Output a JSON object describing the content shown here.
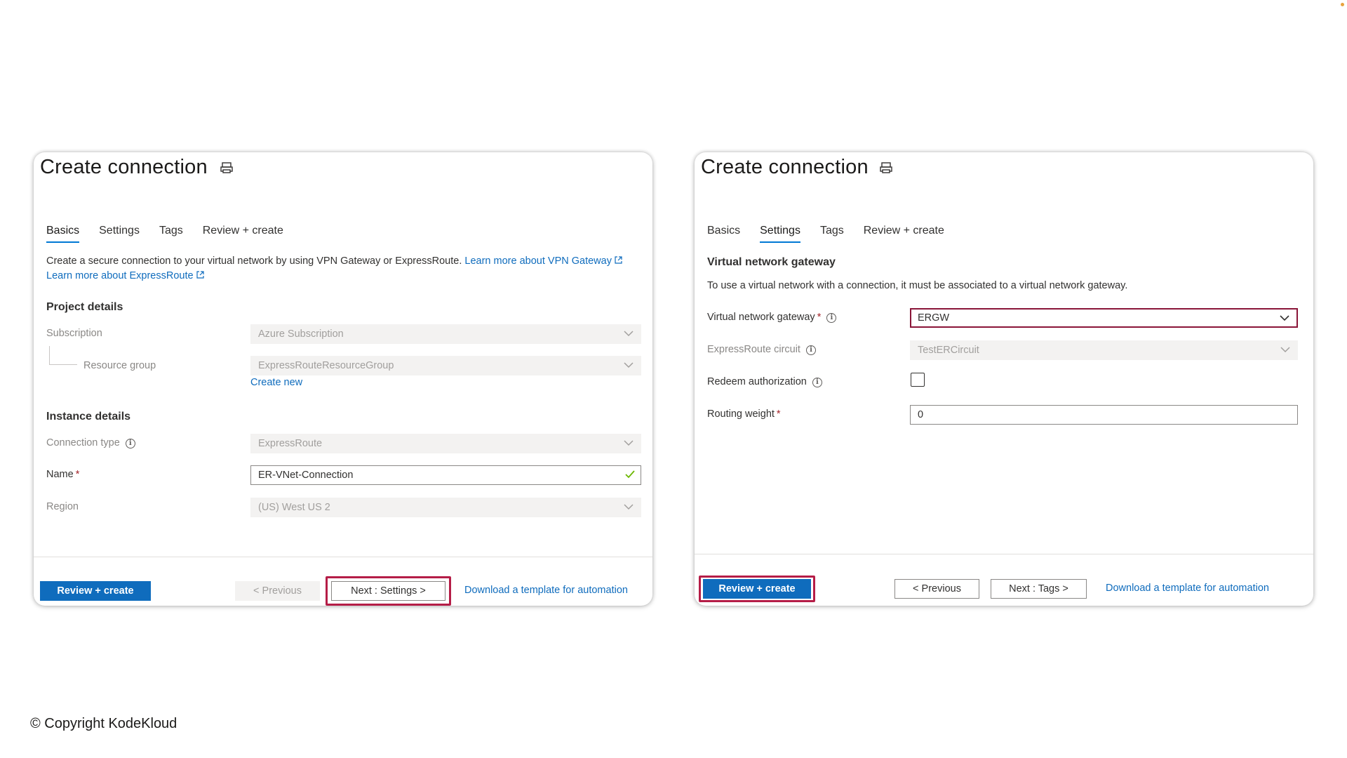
{
  "left_panel": {
    "title": "Create connection",
    "tabs": [
      {
        "label": "Basics",
        "active": true
      },
      {
        "label": "Settings",
        "active": false
      },
      {
        "label": "Tags",
        "active": false
      },
      {
        "label": "Review + create",
        "active": false
      }
    ],
    "intro_text": "Create a secure connection to your virtual network by using VPN Gateway or ExpressRoute.",
    "intro_link_vpn": "Learn more about VPN Gateway",
    "intro_link_er": "Learn more about ExpressRoute",
    "project_details": {
      "heading": "Project details",
      "subscription_label": "Subscription",
      "subscription_value": "Azure Subscription",
      "resource_group_label": "Resource group",
      "resource_group_value": "ExpressRouteResourceGroup",
      "create_new_link": "Create new"
    },
    "instance_details": {
      "heading": "Instance details",
      "connection_type_label": "Connection type",
      "connection_type_value": "ExpressRoute",
      "name_label": "Name",
      "name_value": "ER-VNet-Connection",
      "region_label": "Region",
      "region_value": "(US) West US 2"
    },
    "footer": {
      "review_create": "Review + create",
      "previous": "< Previous",
      "next": "Next : Settings >",
      "download": "Download a template for automation"
    }
  },
  "right_panel": {
    "title": "Create connection",
    "tabs": [
      {
        "label": "Basics",
        "active": false
      },
      {
        "label": "Settings",
        "active": true
      },
      {
        "label": "Tags",
        "active": false
      },
      {
        "label": "Review + create",
        "active": false
      }
    ],
    "section_heading": "Virtual network gateway",
    "section_description": "To use a virtual network with a connection, it must be associated to a virtual network gateway.",
    "fields": {
      "vng_label": "Virtual network gateway",
      "vng_value": "ERGW",
      "circuit_label": "ExpressRoute circuit",
      "circuit_value": "TestERCircuit",
      "redeem_label": "Redeem authorization",
      "redeem_checked": false,
      "routing_weight_label": "Routing weight",
      "routing_weight_value": "0"
    },
    "footer": {
      "review_create": "Review + create",
      "previous": "< Previous",
      "next": "Next : Tags >",
      "download": "Download a template for automation"
    }
  },
  "required_marker": "*",
  "info_glyph": "i",
  "icons": [
    "pin-icon",
    "external-link-icon",
    "chevron-down-icon",
    "checkmark-icon",
    "info-icon"
  ],
  "colors": {
    "accent": "#0f6cbd",
    "highlight": "#b51d47",
    "required": "#a4262c"
  },
  "copyright": "© Copyright KodeKloud"
}
